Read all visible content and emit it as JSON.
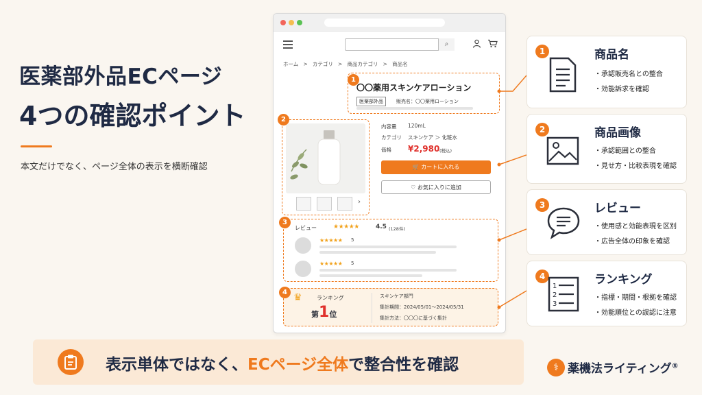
{
  "title": {
    "line1": "医薬部外品ECページ",
    "line2": "4つの確認ポイント",
    "subtitle": "本文だけでなく、ページ全体の表示を横断確認"
  },
  "mock": {
    "breadcrumb": [
      "ホーム",
      "カテゴリ",
      "商品カテゴリ",
      "商品名"
    ],
    "breadcrumb_sep": ">",
    "product_name": "〇〇薬用スキンケアローション",
    "tag": "医薬部外品",
    "seller": "販売名：〇〇薬用ローション",
    "specs": [
      {
        "label": "内容量",
        "value": "120mL"
      },
      {
        "label": "カテゴリ",
        "value": "スキンケア ＞ 化粧水"
      }
    ],
    "price_label": "価格",
    "price": "¥2,980",
    "price_tax": "(税込)",
    "cart_button": "カートに入れる",
    "fav_button": "お気に入りに追加",
    "review_label": "レビュー",
    "review_stars": "★★★★★",
    "review_score": "4.5",
    "review_count": "(128件)",
    "reviews": [
      {
        "stars": "★★★★★",
        "score": "5"
      },
      {
        "stars": "★★★★★",
        "score": "5"
      }
    ],
    "ranking_label": "ランキング",
    "rank_prefix": "第",
    "rank_number": "1",
    "rank_suffix": "位",
    "rank_category": "スキンケア部門",
    "rank_period": "集計期間：2024/05/01〜2024/05/31",
    "rank_method": "集計方法：〇〇〇に基づく集計",
    "badges": [
      "1",
      "2",
      "3",
      "4"
    ]
  },
  "cards": [
    {
      "num": "1",
      "title": "商品名",
      "icon": "document-icon",
      "items": [
        "・承認販売名との整合",
        "・効能訴求を確認"
      ]
    },
    {
      "num": "2",
      "title": "商品画像",
      "icon": "image-icon",
      "items": [
        "・承認範囲との整合",
        "・見せ方・比較表現を確認"
      ]
    },
    {
      "num": "3",
      "title": "レビュー",
      "icon": "speech-bubble-icon",
      "items": [
        "・使用感と効能表現を区別",
        "・広告全体の印象を確認"
      ]
    },
    {
      "num": "4",
      "title": "ランキング",
      "icon": "numbered-list-icon",
      "items": [
        "・指標・期間・根拠を確認",
        "・効能順位との誤認に注意"
      ]
    }
  ],
  "banner": {
    "part1": "表示単体ではなく、",
    "highlight": "ECページ全体",
    "part2": "で整合性を確認"
  },
  "logo": {
    "text": "薬機法ライティング",
    "mark": "®"
  },
  "colors": {
    "accent": "#ef7a1e",
    "navy": "#1f2a44",
    "price": "#e0312c",
    "background": "#faf6f0"
  }
}
